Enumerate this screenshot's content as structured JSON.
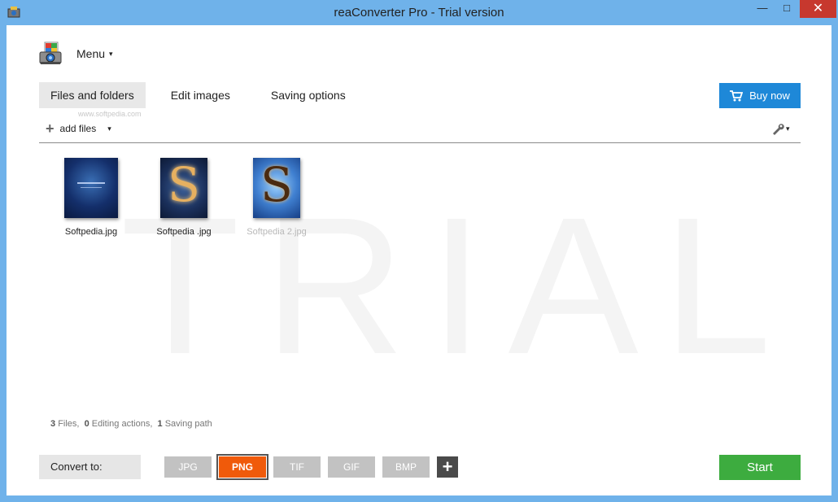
{
  "window": {
    "title": "reaConverter Pro - Trial version",
    "minimize_glyph": "—",
    "maximize_glyph": "□",
    "close_glyph": "✕"
  },
  "menu": {
    "label": "Menu",
    "caret": "▾"
  },
  "tabs": [
    {
      "label": "Files and folders",
      "active": true
    },
    {
      "label": "Edit images",
      "active": false
    },
    {
      "label": "Saving options",
      "active": false
    }
  ],
  "watermark": {
    "subtitle": "www.softpedia.com",
    "trial_text": "TRIAL"
  },
  "buy": {
    "label": "Buy now",
    "icon": "cart-icon"
  },
  "toolbar": {
    "add_files_label": "add files",
    "add_icon": "+",
    "caret": "▾",
    "settings_icon": "wrench-icon"
  },
  "files": [
    {
      "name": "Softpedia.jpg",
      "dimmed": false
    },
    {
      "name": "Softpedia .jpg",
      "dimmed": false
    },
    {
      "name": "Softpedia 2.jpg",
      "dimmed": true
    }
  ],
  "summary": {
    "files_count": "3",
    "files_label": "Files,",
    "editing_count": "0",
    "editing_label": "Editing actions,",
    "saving_count": "1",
    "saving_label": "Saving path"
  },
  "convert": {
    "label": "Convert to:",
    "formats": [
      {
        "label": "JPG",
        "selected": false
      },
      {
        "label": "PNG",
        "selected": true
      },
      {
        "label": "TIF",
        "selected": false
      },
      {
        "label": "GIF",
        "selected": false
      },
      {
        "label": "BMP",
        "selected": false
      }
    ],
    "add_glyph": "+"
  },
  "start": {
    "label": "Start"
  },
  "colors": {
    "accent_blue": "#1e88d8",
    "start_green": "#3dac3f",
    "selected_format": "#f05a0a",
    "titlebar": "#6fb2ea",
    "close": "#c7382e"
  }
}
